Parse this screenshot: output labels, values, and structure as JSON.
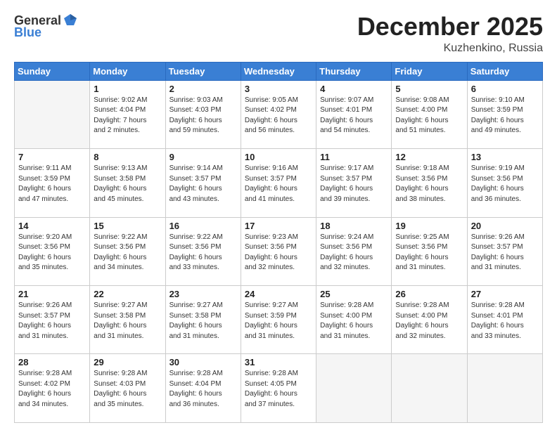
{
  "header": {
    "logo_line1": "General",
    "logo_line2": "Blue",
    "month_title": "December 2025",
    "location": "Kuzhenkino, Russia"
  },
  "days_of_week": [
    "Sunday",
    "Monday",
    "Tuesday",
    "Wednesday",
    "Thursday",
    "Friday",
    "Saturday"
  ],
  "weeks": [
    [
      {
        "day": "",
        "info": ""
      },
      {
        "day": "1",
        "info": "Sunrise: 9:02 AM\nSunset: 4:04 PM\nDaylight: 7 hours\nand 2 minutes."
      },
      {
        "day": "2",
        "info": "Sunrise: 9:03 AM\nSunset: 4:03 PM\nDaylight: 6 hours\nand 59 minutes."
      },
      {
        "day": "3",
        "info": "Sunrise: 9:05 AM\nSunset: 4:02 PM\nDaylight: 6 hours\nand 56 minutes."
      },
      {
        "day": "4",
        "info": "Sunrise: 9:07 AM\nSunset: 4:01 PM\nDaylight: 6 hours\nand 54 minutes."
      },
      {
        "day": "5",
        "info": "Sunrise: 9:08 AM\nSunset: 4:00 PM\nDaylight: 6 hours\nand 51 minutes."
      },
      {
        "day": "6",
        "info": "Sunrise: 9:10 AM\nSunset: 3:59 PM\nDaylight: 6 hours\nand 49 minutes."
      }
    ],
    [
      {
        "day": "7",
        "info": "Sunrise: 9:11 AM\nSunset: 3:59 PM\nDaylight: 6 hours\nand 47 minutes."
      },
      {
        "day": "8",
        "info": "Sunrise: 9:13 AM\nSunset: 3:58 PM\nDaylight: 6 hours\nand 45 minutes."
      },
      {
        "day": "9",
        "info": "Sunrise: 9:14 AM\nSunset: 3:57 PM\nDaylight: 6 hours\nand 43 minutes."
      },
      {
        "day": "10",
        "info": "Sunrise: 9:16 AM\nSunset: 3:57 PM\nDaylight: 6 hours\nand 41 minutes."
      },
      {
        "day": "11",
        "info": "Sunrise: 9:17 AM\nSunset: 3:57 PM\nDaylight: 6 hours\nand 39 minutes."
      },
      {
        "day": "12",
        "info": "Sunrise: 9:18 AM\nSunset: 3:56 PM\nDaylight: 6 hours\nand 38 minutes."
      },
      {
        "day": "13",
        "info": "Sunrise: 9:19 AM\nSunset: 3:56 PM\nDaylight: 6 hours\nand 36 minutes."
      }
    ],
    [
      {
        "day": "14",
        "info": "Sunrise: 9:20 AM\nSunset: 3:56 PM\nDaylight: 6 hours\nand 35 minutes."
      },
      {
        "day": "15",
        "info": "Sunrise: 9:22 AM\nSunset: 3:56 PM\nDaylight: 6 hours\nand 34 minutes."
      },
      {
        "day": "16",
        "info": "Sunrise: 9:22 AM\nSunset: 3:56 PM\nDaylight: 6 hours\nand 33 minutes."
      },
      {
        "day": "17",
        "info": "Sunrise: 9:23 AM\nSunset: 3:56 PM\nDaylight: 6 hours\nand 32 minutes."
      },
      {
        "day": "18",
        "info": "Sunrise: 9:24 AM\nSunset: 3:56 PM\nDaylight: 6 hours\nand 32 minutes."
      },
      {
        "day": "19",
        "info": "Sunrise: 9:25 AM\nSunset: 3:56 PM\nDaylight: 6 hours\nand 31 minutes."
      },
      {
        "day": "20",
        "info": "Sunrise: 9:26 AM\nSunset: 3:57 PM\nDaylight: 6 hours\nand 31 minutes."
      }
    ],
    [
      {
        "day": "21",
        "info": "Sunrise: 9:26 AM\nSunset: 3:57 PM\nDaylight: 6 hours\nand 31 minutes."
      },
      {
        "day": "22",
        "info": "Sunrise: 9:27 AM\nSunset: 3:58 PM\nDaylight: 6 hours\nand 31 minutes."
      },
      {
        "day": "23",
        "info": "Sunrise: 9:27 AM\nSunset: 3:58 PM\nDaylight: 6 hours\nand 31 minutes."
      },
      {
        "day": "24",
        "info": "Sunrise: 9:27 AM\nSunset: 3:59 PM\nDaylight: 6 hours\nand 31 minutes."
      },
      {
        "day": "25",
        "info": "Sunrise: 9:28 AM\nSunset: 4:00 PM\nDaylight: 6 hours\nand 31 minutes."
      },
      {
        "day": "26",
        "info": "Sunrise: 9:28 AM\nSunset: 4:00 PM\nDaylight: 6 hours\nand 32 minutes."
      },
      {
        "day": "27",
        "info": "Sunrise: 9:28 AM\nSunset: 4:01 PM\nDaylight: 6 hours\nand 33 minutes."
      }
    ],
    [
      {
        "day": "28",
        "info": "Sunrise: 9:28 AM\nSunset: 4:02 PM\nDaylight: 6 hours\nand 34 minutes."
      },
      {
        "day": "29",
        "info": "Sunrise: 9:28 AM\nSunset: 4:03 PM\nDaylight: 6 hours\nand 35 minutes."
      },
      {
        "day": "30",
        "info": "Sunrise: 9:28 AM\nSunset: 4:04 PM\nDaylight: 6 hours\nand 36 minutes."
      },
      {
        "day": "31",
        "info": "Sunrise: 9:28 AM\nSunset: 4:05 PM\nDaylight: 6 hours\nand 37 minutes."
      },
      {
        "day": "",
        "info": ""
      },
      {
        "day": "",
        "info": ""
      },
      {
        "day": "",
        "info": ""
      }
    ]
  ]
}
